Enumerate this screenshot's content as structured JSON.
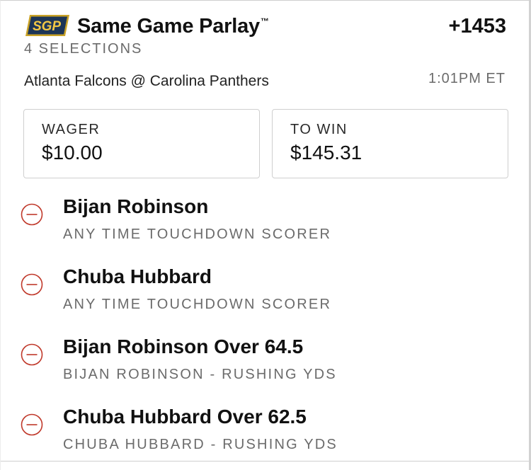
{
  "header": {
    "badge": "SGP",
    "title": "Same Game Parlay",
    "trademark": "™",
    "odds": "+1453",
    "selections": "4 SELECTIONS"
  },
  "game": {
    "matchup": "Atlanta Falcons @ Carolina Panthers",
    "time": "1:01PM ET"
  },
  "wager": {
    "label": "WAGER",
    "value": "$10.00"
  },
  "to_win": {
    "label": "TO WIN",
    "value": "$145.31"
  },
  "legs": [
    {
      "title": "Bijan Robinson",
      "market": "ANY TIME TOUCHDOWN SCORER",
      "icon": "minus-circle-icon"
    },
    {
      "title": "Chuba Hubbard",
      "market": "ANY TIME TOUCHDOWN SCORER",
      "icon": "minus-circle-icon"
    },
    {
      "title": "Bijan Robinson Over 64.5",
      "market": "BIJAN ROBINSON - RUSHING YDS",
      "icon": "minus-circle-icon"
    },
    {
      "title": "Chuba Hubbard Over 62.5",
      "market": "CHUBA HUBBARD - RUSHING YDS",
      "icon": "minus-circle-icon"
    }
  ],
  "colors": {
    "badge_bg": "#1d3557",
    "badge_border": "#c9a227",
    "badge_text": "#f2c744",
    "remove_icon": "#c0392b",
    "muted_text": "#6b6b6b"
  }
}
